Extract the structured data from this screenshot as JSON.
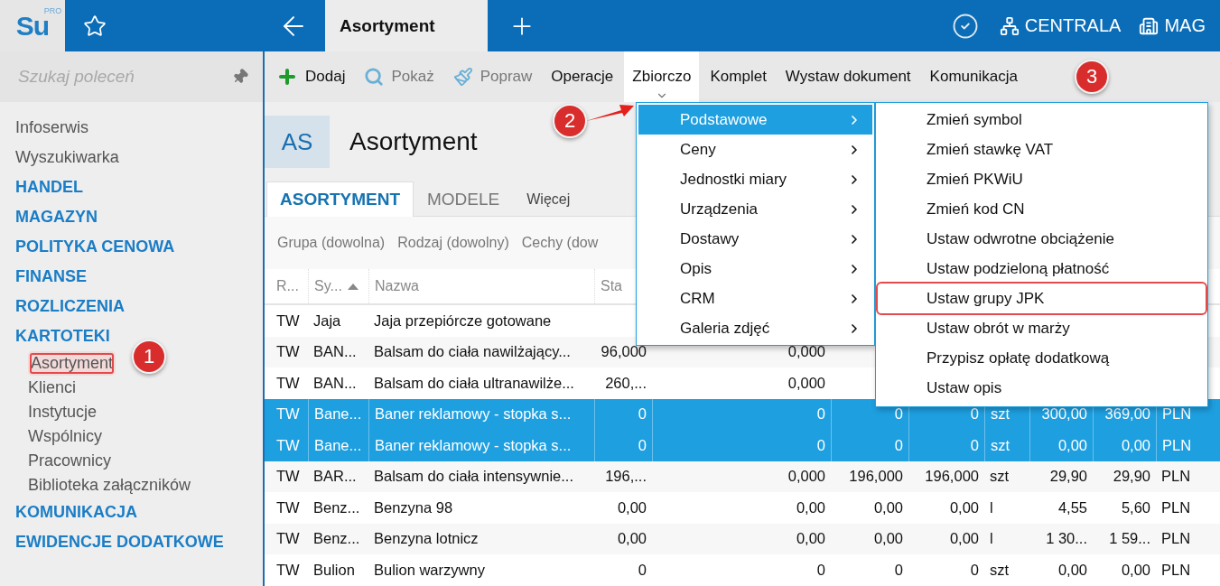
{
  "logo": {
    "text": "Su",
    "badge": "PRO"
  },
  "top_bar": {
    "tab": {
      "label": "Asortyment",
      "selected": true
    },
    "company": "CENTRALA",
    "warehouse": "MAG"
  },
  "sidebar": {
    "search": {
      "placeholder": "Szukaj poleceń"
    },
    "items": [
      {
        "label": "Infoserwis",
        "kind": "link",
        "highlighted": false
      },
      {
        "label": "Wyszukiwarka",
        "kind": "link",
        "highlighted": false
      },
      {
        "label": "HANDEL",
        "kind": "group",
        "highlighted": false
      },
      {
        "label": "MAGAZYN",
        "kind": "group",
        "highlighted": false
      },
      {
        "label": "POLITYKA CENOWA",
        "kind": "group",
        "highlighted": false
      },
      {
        "label": "FINANSE",
        "kind": "group",
        "highlighted": false
      },
      {
        "label": "ROZLICZENIA",
        "kind": "group",
        "highlighted": false
      },
      {
        "label": "KARTOTEKI",
        "kind": "group",
        "highlighted": false,
        "children": [
          {
            "label": "Asortyment",
            "kind": "link",
            "highlighted": true
          },
          {
            "label": "Klienci",
            "kind": "link",
            "highlighted": false
          },
          {
            "label": "Instytucje",
            "kind": "link",
            "highlighted": false
          },
          {
            "label": "Wspólnicy",
            "kind": "link",
            "highlighted": false
          },
          {
            "label": "Pracownicy",
            "kind": "link",
            "highlighted": false
          },
          {
            "label": "Biblioteka załączników",
            "kind": "link",
            "highlighted": false
          }
        ]
      },
      {
        "label": "KOMUNIKACJA",
        "kind": "group",
        "highlighted": false
      },
      {
        "label": "EWIDENCJE DODATKOWE",
        "kind": "group",
        "highlighted": false
      }
    ]
  },
  "toolbar": [
    {
      "label": "Dodaj",
      "kind": "icon",
      "disabled": false,
      "open": false
    },
    {
      "label": "Pokaż",
      "kind": "icon",
      "disabled": true,
      "open": false
    },
    {
      "label": "Popraw",
      "kind": "icon",
      "disabled": true,
      "open": false
    },
    {
      "label": "Operacje",
      "kind": "text",
      "disabled": false,
      "open": false
    },
    {
      "label": "Zbiorczo",
      "kind": "text",
      "disabled": false,
      "open": true
    },
    {
      "label": "Komplet",
      "kind": "text",
      "disabled": false,
      "open": false
    },
    {
      "label": "Wystaw dokument",
      "kind": "text",
      "disabled": false,
      "open": false
    },
    {
      "label": "Komunikacja",
      "kind": "text",
      "disabled": false,
      "open": false
    }
  ],
  "header": {
    "badge": "AS",
    "title": "Asortyment"
  },
  "tabs": [
    {
      "label": "ASORTYMENT",
      "kind": "tab",
      "selected": true
    },
    {
      "label": "MODELE",
      "kind": "tab",
      "selected": false
    },
    {
      "label": "Więcej",
      "kind": "more",
      "selected": false
    }
  ],
  "filters": [
    "Grupa (dowolna)",
    "Rodzaj (dowolny)",
    "Cechy (dow"
  ],
  "table": {
    "columns": [
      {
        "label": "R...",
        "sorted": false
      },
      {
        "label": "Sy...",
        "sorted": true
      },
      {
        "label": "Nazwa",
        "sorted": false
      },
      {
        "label": "Sta",
        "sorted": false
      }
    ],
    "rows": [
      {
        "selected": false,
        "cells": [
          "TW",
          "Jaja",
          "Jaja przepiórcze gotowane",
          null,
          null,
          null,
          null,
          null,
          null,
          null,
          null
        ]
      },
      {
        "selected": false,
        "cells": [
          "TW",
          "BAN...",
          "Balsam do ciała nawilżający...",
          "96,000",
          "0,000",
          null,
          null,
          null,
          null,
          null,
          null
        ]
      },
      {
        "selected": false,
        "cells": [
          "TW",
          "BAN...",
          "Balsam do ciała ultranawilże...",
          "260,...",
          "0,000",
          null,
          null,
          null,
          null,
          null,
          null
        ]
      },
      {
        "selected": true,
        "cells": [
          "TW",
          "Bane...",
          "Baner reklamowy - stopka s...",
          "0",
          "0",
          "0",
          "0",
          "szt",
          "300,00",
          "369,00",
          "PLN"
        ]
      },
      {
        "selected": true,
        "cells": [
          "TW",
          "Bane...",
          "Baner reklamowy - stopka s...",
          "0",
          "0",
          "0",
          "0",
          "szt",
          "0,00",
          "0,00",
          "PLN"
        ]
      },
      {
        "selected": false,
        "cells": [
          "TW",
          "BAR...",
          "Balsam do ciała intensywnie...",
          "196,...",
          "0,000",
          "196,000",
          "196,000",
          "szt",
          "29,90",
          "29,90",
          "PLN"
        ]
      },
      {
        "selected": false,
        "cells": [
          "TW",
          "Benz...",
          "Benzyna 98",
          "0,00",
          "0,00",
          "0,00",
          "0,00",
          "l",
          "4,55",
          "5,60",
          "PLN"
        ]
      },
      {
        "selected": false,
        "cells": [
          "TW",
          "Benz...",
          "Benzyna lotnicz",
          "0,00",
          "0,00",
          "0,00",
          "0,00",
          "l",
          "1 30...",
          "1 59...",
          "PLN"
        ]
      },
      {
        "selected": false,
        "cells": [
          "TW",
          "Bulion",
          "Bulion warzywny",
          "0",
          "0",
          "0",
          "0",
          "szt",
          "0,00",
          "0,00",
          "PLN"
        ]
      }
    ]
  },
  "menu": {
    "items": [
      {
        "label": "Podstawowe",
        "selected": true
      },
      {
        "label": "Ceny",
        "selected": false
      },
      {
        "label": "Jednostki miary",
        "selected": false
      },
      {
        "label": "Urządzenia",
        "selected": false
      },
      {
        "label": "Dostawy",
        "selected": false
      },
      {
        "label": "Opis",
        "selected": false
      },
      {
        "label": "CRM",
        "selected": false
      },
      {
        "label": "Galeria zdjęć",
        "selected": false
      }
    ],
    "submenu": [
      {
        "label": "Zmień symbol",
        "highlighted": false
      },
      {
        "label": "Zmień stawkę VAT",
        "highlighted": false
      },
      {
        "label": "Zmień PKWiU",
        "highlighted": false
      },
      {
        "label": "Zmień kod CN",
        "highlighted": false
      },
      {
        "label": "Ustaw odwrotne obciążenie",
        "highlighted": false
      },
      {
        "label": "Ustaw podzieloną płatność",
        "highlighted": false
      },
      {
        "label": "Ustaw grupy JPK",
        "highlighted": true
      },
      {
        "label": "Ustaw obrót w marży",
        "highlighted": false
      },
      {
        "label": "Przypisz opłatę dodatkową",
        "highlighted": false
      },
      {
        "label": "Ustaw opis",
        "highlighted": false
      }
    ]
  },
  "annotations": [
    "1",
    "2",
    "3"
  ]
}
